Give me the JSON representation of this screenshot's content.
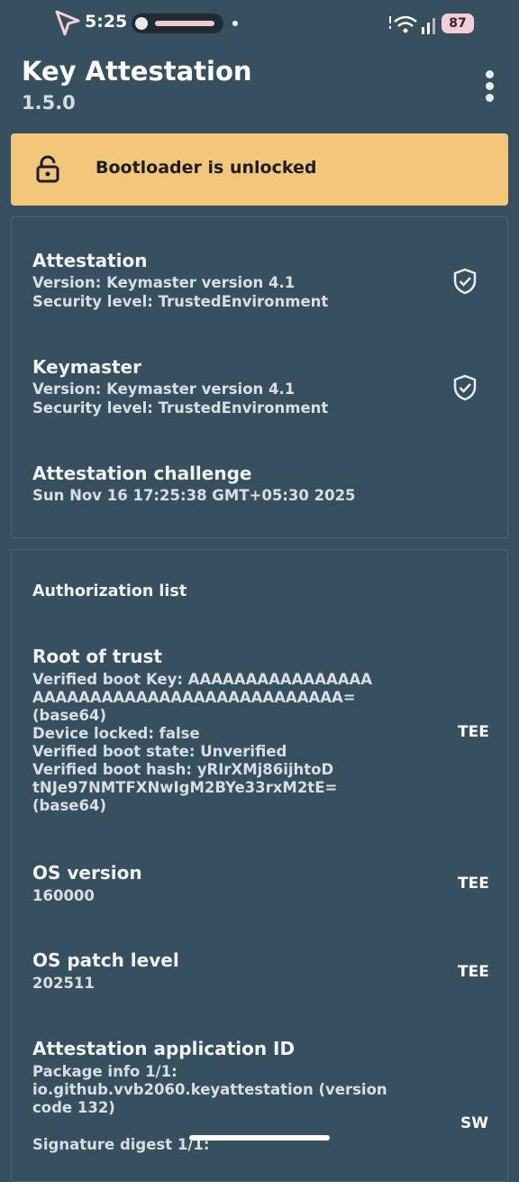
{
  "status_bar": {
    "time": "5:25",
    "battery": "87",
    "icons": [
      "cursor-arrow-icon",
      "media-icon",
      "wifi-icon",
      "signal-icon"
    ]
  },
  "header": {
    "title": "Key Attestation",
    "version": "1.5.0",
    "menu_icon": "more-vertical-icon"
  },
  "banner": {
    "text": "Bootloader is unlocked",
    "icon": "lock-open-icon",
    "color": "#f2c67b"
  },
  "attestation_card": {
    "attestation": {
      "title": "Attestation",
      "version": "Version: Keymaster version 4.1",
      "security": "Security level: TrustedEnvironment"
    },
    "keymaster": {
      "title": "Keymaster",
      "version": "Version: Keymaster version 4.1",
      "security": "Security level: TrustedEnvironment"
    },
    "challenge": {
      "title": "Attestation challenge",
      "value": "Sun Nov 16 17:25:38 GMT+05:30 2025"
    }
  },
  "authorization_card": {
    "heading": "Authorization list",
    "root_of_trust": {
      "title": "Root of trust",
      "lines": [
        "Verified boot Key: AAAAAAAAAAAAAAAA",
        "AAAAAAAAAAAAAAAAAAAAAAAAAAA=",
        "(base64)",
        "Device locked: false",
        "Verified boot state: Unverified",
        "Verified boot hash: yRIrXMj86ijhtoD",
        "tNJe97NMTFXNwIgM2BYe33rxM2tE=",
        "(base64)"
      ],
      "tag": "TEE"
    },
    "os_version": {
      "title": "OS version",
      "value": "160000",
      "tag": "TEE"
    },
    "os_patch": {
      "title": "OS patch level",
      "value": "202511",
      "tag": "TEE"
    },
    "app_id": {
      "title": "Attestation application ID",
      "lines": [
        "Package info 1/1:",
        "io.github.vvb2060.keyattestation (version",
        "code 132)"
      ],
      "extra": "Signature digest 1/1:",
      "tag": "SW"
    }
  },
  "colors": {
    "background": "#37505f",
    "banner": "#f2c67b",
    "card_border": "#4d6676"
  }
}
